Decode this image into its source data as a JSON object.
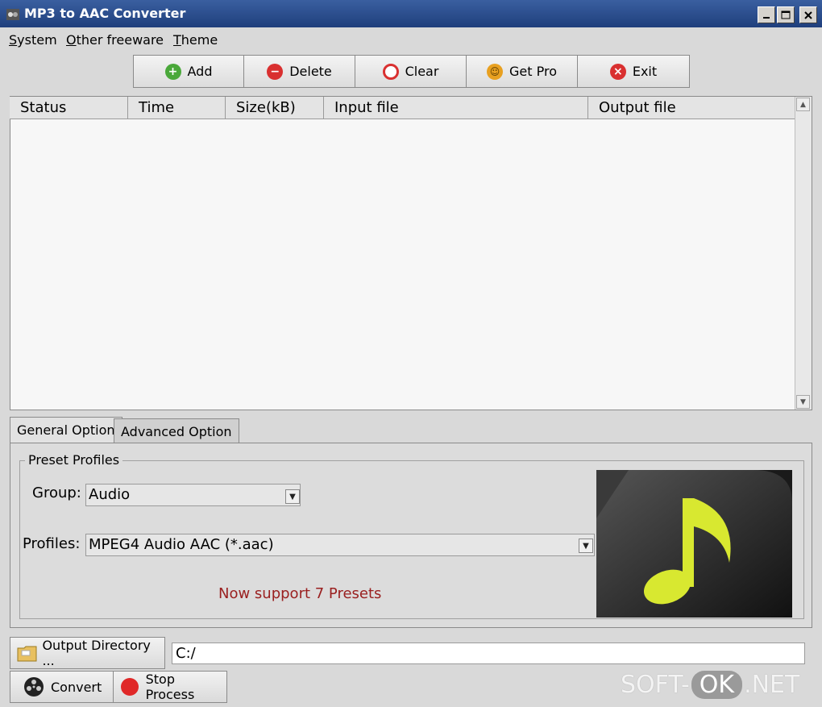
{
  "window": {
    "title": "MP3 to AAC Converter"
  },
  "menu": [
    {
      "label": "System"
    },
    {
      "label": "Other freeware"
    },
    {
      "label": "Theme"
    }
  ],
  "toolbar": {
    "add": "Add",
    "delete": "Delete",
    "clear": "Clear",
    "get_pro": "Get Pro",
    "exit": "Exit"
  },
  "file_list": {
    "columns": [
      "Status",
      "Time",
      "Size(kB)",
      "Input file",
      "Output file"
    ],
    "rows": []
  },
  "tabs": {
    "general": "General Option",
    "advanced": "Advanced Option"
  },
  "preset": {
    "legend": "Preset Profiles",
    "group_label": "Group:",
    "group_value": "Audio",
    "profiles_label": "Profiles:",
    "profiles_value": "MPEG4 Audio AAC (*.aac)",
    "notice": "Now support 7 Presets"
  },
  "bottom": {
    "output_dir_button": "Output Directory ...",
    "output_dir_value": "C:/",
    "convert": "Convert",
    "stop": "Stop Process"
  },
  "watermark": {
    "left": "SOFT-",
    "mid": "OK",
    "right": ".NET"
  },
  "colors": {
    "notice": "#9a2020",
    "note_icon": "#d8e830",
    "titlebar": "#2a4f8f"
  }
}
